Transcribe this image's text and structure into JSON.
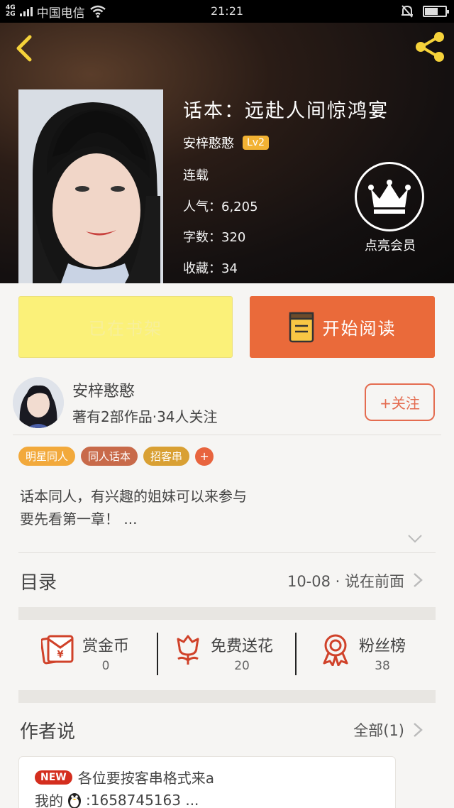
{
  "status_bar": {
    "network_top": "4G",
    "network_bottom": "2G",
    "carrier": "中国电信",
    "time": "21:21"
  },
  "book": {
    "title": "话本：远赴人间惊鸿宴",
    "author": "安梓憨憨",
    "level": "Lv2",
    "status": "连载",
    "popularity_label": "人气：6,205",
    "word_count_label": "字数：320",
    "favorites_label": "收藏：34"
  },
  "vip": {
    "label": "点亮会员"
  },
  "actions": {
    "on_shelf_label": "已在书架",
    "start_reading_label": "开始阅读"
  },
  "author_info": {
    "name": "安梓憨憨",
    "stats": "著有2部作品·34人关注",
    "follow_label": "+关注"
  },
  "tags": [
    {
      "label": "明星同人",
      "color": "#f2a93b"
    },
    {
      "label": "同人话本",
      "color": "#c86a4a"
    },
    {
      "label": "招客串",
      "color": "#d9a033"
    }
  ],
  "tag_add_label": "+",
  "description": {
    "line1": "话本同人，有兴趣的姐妹可以来参与",
    "line2": "要先看第一章！ ..."
  },
  "catalog": {
    "label": "目录",
    "latest": "10-08 · 说在前面"
  },
  "stats": {
    "reward": {
      "label": "赏金币",
      "value": "0"
    },
    "flowers": {
      "label": "免费送花",
      "value": "20"
    },
    "fans": {
      "label": "粉丝榜",
      "value": "38"
    }
  },
  "author_says": {
    "label": "作者说",
    "all_label": "全部(1)",
    "badge": "NEW",
    "line1": "各位要按客串格式来a",
    "line2_prefix": "我的",
    "line2_text": ":1658745163 ..."
  },
  "colors": {
    "accent_orange": "#ea6a3a",
    "shelf_yellow": "#fbf179",
    "level_badge": "#f2b233",
    "icon_red": "#d0422a",
    "new_badge": "#d42e1e"
  }
}
